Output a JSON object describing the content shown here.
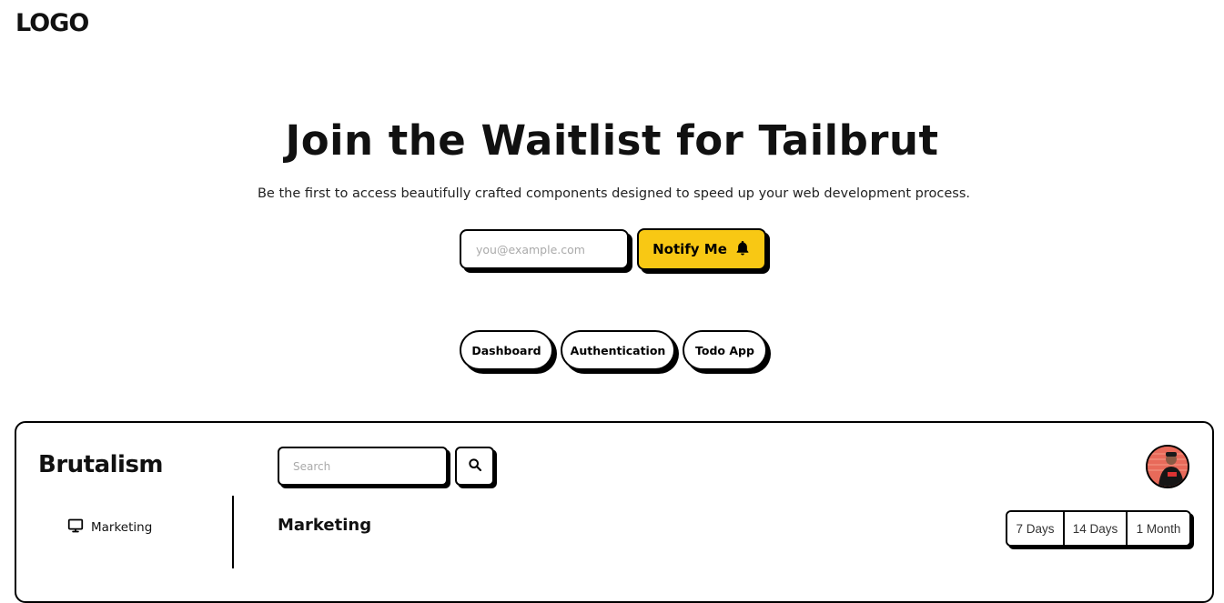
{
  "header": {
    "logo": "LOGO"
  },
  "hero": {
    "title": "Join the Waitlist for Tailbrut",
    "subtitle": "Be the first to access beautifully crafted components designed to speed up your web development process.",
    "email_placeholder": "you@example.com",
    "notify_label": "Notify Me",
    "notify_icon": "bell-icon",
    "accent_color": "#f8c814"
  },
  "demo_tabs": [
    {
      "label": "Dashboard"
    },
    {
      "label": "Authentication"
    },
    {
      "label": "Todo App"
    }
  ],
  "preview": {
    "brand": "Brutalism",
    "search_placeholder": "Search",
    "search_icon": "search-icon",
    "sidebar_items": [
      {
        "label": "Marketing",
        "icon": "monitor-icon"
      }
    ],
    "section_title": "Marketing",
    "ranges": [
      "7 Days",
      "14 Days",
      "1 Month"
    ]
  }
}
